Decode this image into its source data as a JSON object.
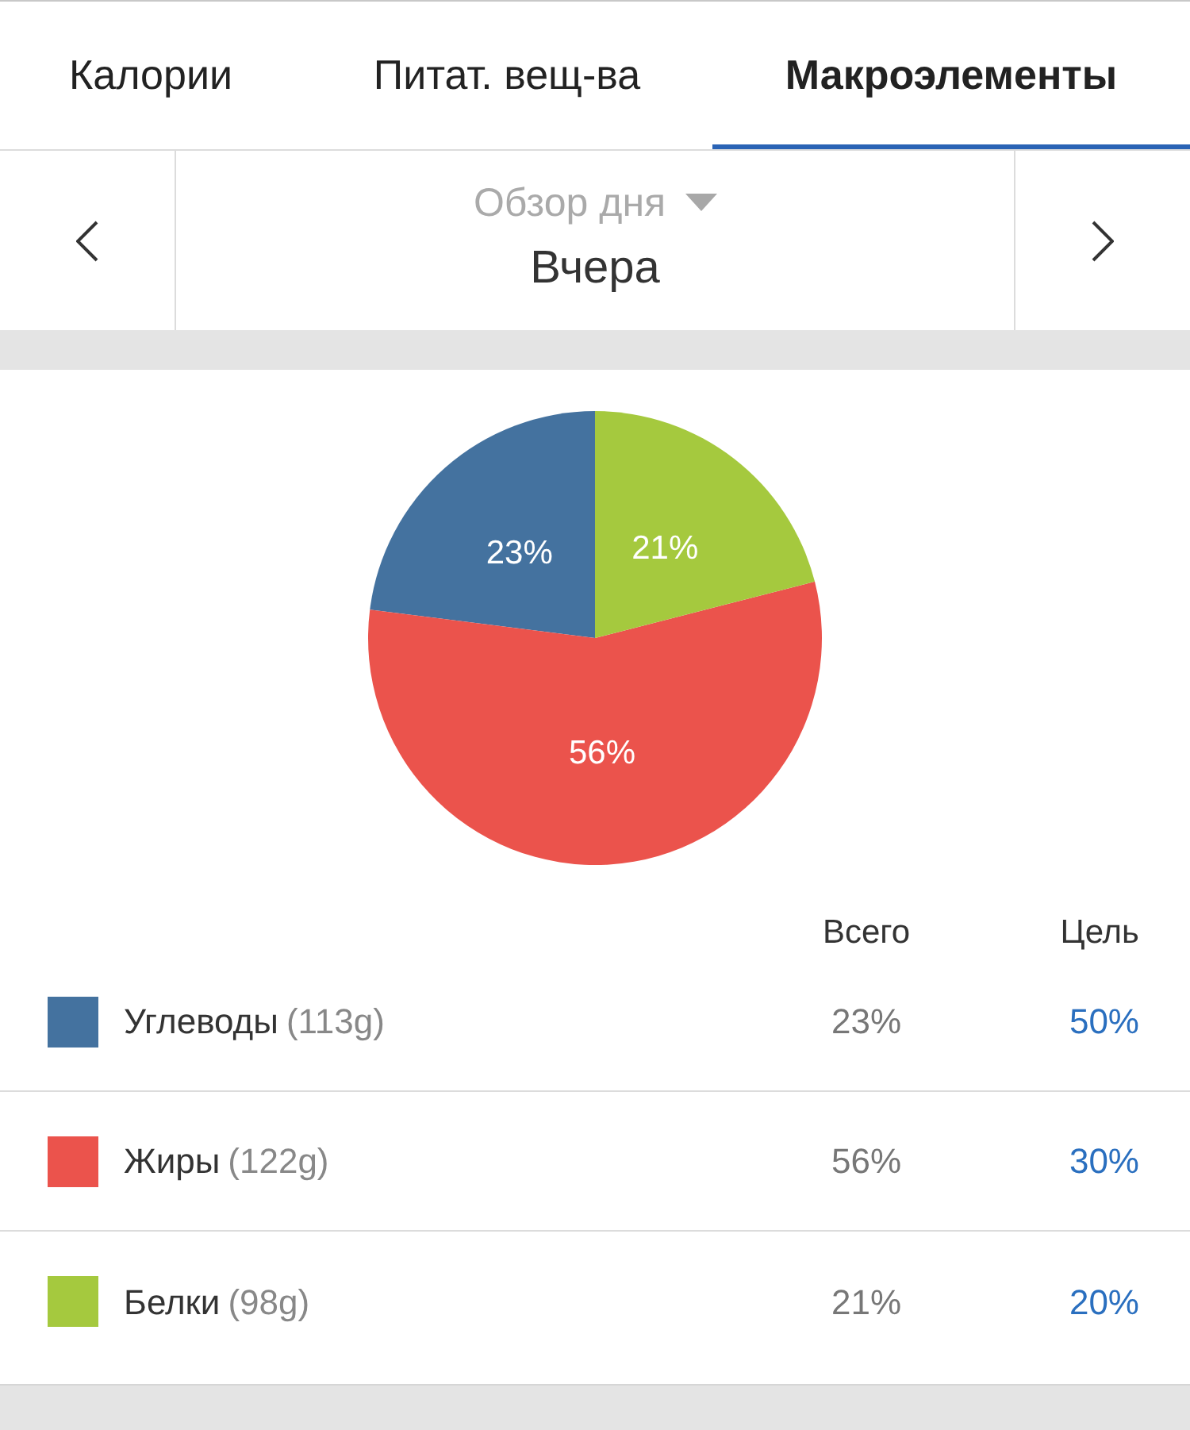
{
  "tabs": [
    {
      "label": "Калории",
      "selected": false
    },
    {
      "label": "Питат. вещ-ва",
      "selected": false
    },
    {
      "label": "Макроэлементы",
      "selected": true
    }
  ],
  "date_nav": {
    "view_label": "Обзор дня",
    "date": "Вчера"
  },
  "chart": {
    "chart_data": {
      "type": "pie",
      "values": [
        23,
        56,
        21
      ],
      "value_labels": [
        "23%",
        "56%",
        "21%"
      ]
    }
  },
  "legend": {
    "columns": [
      "Всего",
      "Цель"
    ],
    "rows": [
      {
        "name": "Углеводы",
        "amount": "(113g)",
        "total": "23%",
        "goal": "50%",
        "color": "#44729f"
      },
      {
        "name": "Жиры",
        "amount": "(122g)",
        "total": "56%",
        "goal": "30%",
        "color": "#eb534c"
      },
      {
        "name": "Белки",
        "amount": "(98g)",
        "total": "21%",
        "goal": "20%",
        "color": "#a5c93e"
      }
    ]
  }
}
